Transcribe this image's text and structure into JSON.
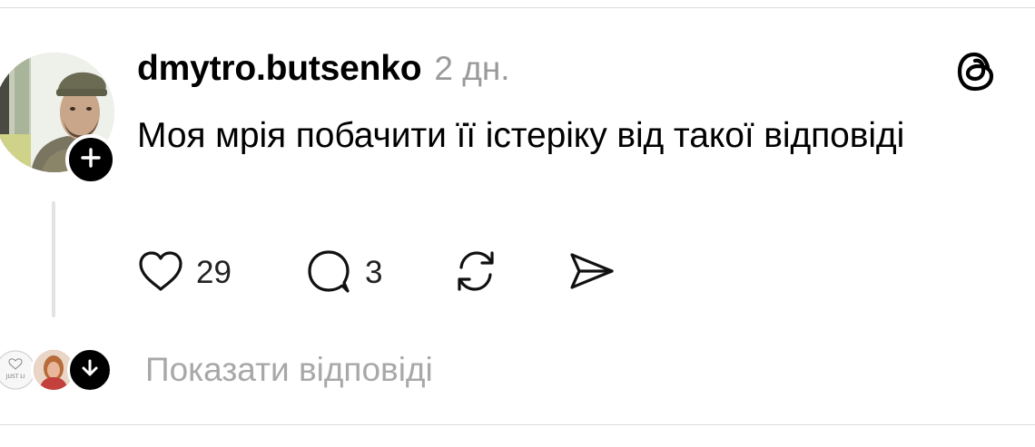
{
  "post": {
    "username": "dmytro.butsenko",
    "timestamp": "2 дн.",
    "text": "Моя мрія побачити її істеріку від такої відповіді",
    "likes": "29",
    "replies": "3"
  },
  "replies_bar": {
    "label": "Показати відповіді",
    "mini_avatar_text": "JUST LI"
  },
  "icons": {
    "follow": "plus-icon",
    "app": "threads-logo-icon",
    "like": "heart-icon",
    "reply": "comment-bubble-icon",
    "repost": "repost-icon",
    "share": "send-icon",
    "expand": "arrow-down-icon"
  },
  "colors": {
    "text": "#000000",
    "muted": "#9a9a9a",
    "divider": "#dcdcdc",
    "thread_line": "#e3e3e3"
  }
}
